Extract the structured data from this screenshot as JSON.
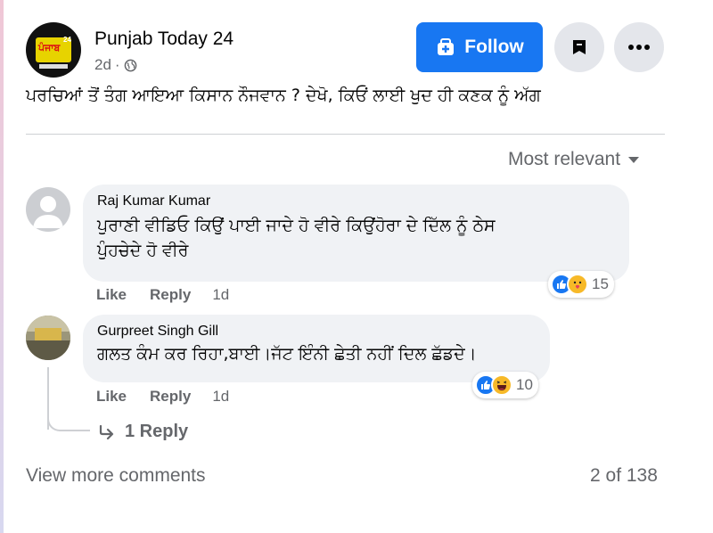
{
  "post": {
    "page_name": "Punjab Today 24",
    "time": "2d",
    "text": "ਪਰਚਿਆਂ ਤੋਂ ਤੰਗ ਆਇਆ ਕਿਸਾਨ ਨੌਜਵਾਨ ? ਦੇਖੋ, ਕਿਓਂ ਲਾਈ ਖੁਦ ਹੀ ਕਣਕ ਨੂੰ ਅੱਗ",
    "logo_text": "ਪੰਜਾਬ",
    "logo_num": "24"
  },
  "header": {
    "follow_label": "Follow"
  },
  "sort": {
    "label": "Most relevant"
  },
  "comments": [
    {
      "author": "Raj Kumar Kumar",
      "line1": "ਪੁਰਾਣੀ ਵੀਡਿਓ ਕਿਉਂ ਪਾਈ ਜਾਦੇ ਹੋ ਵੀਰੇ ਕਿਉਂਹੋਰਾ ਦੇ ਦਿੱਲ ਨੂੰ ਠੇਸ",
      "line2": "ਪੁੰਹਚੇਦੇ ਹੋ ਵੀਰੇ",
      "like": "Like",
      "reply": "Reply",
      "time": "1d",
      "reaction_count": "15"
    },
    {
      "author": "Gurpreet Singh Gill",
      "line1": "ਗਲਤ ਕੰਮ ਕਰ ਰਿਹਾ,ਬਾਈ।ਜੱਟ ਇੰਨੀ ਛੇਤੀ ਨਹੀਂ ਦਿਲ ਛੱਡਦੇ।",
      "like": "Like",
      "reply": "Reply",
      "time": "1d",
      "reaction_count": "10",
      "replies_label": "1 Reply"
    }
  ],
  "footer": {
    "view_more": "View more comments",
    "count": "2 of 138"
  },
  "colors": {
    "accent": "#1877f2",
    "secondary_text": "#65676b",
    "bubble": "#f0f2f5"
  }
}
